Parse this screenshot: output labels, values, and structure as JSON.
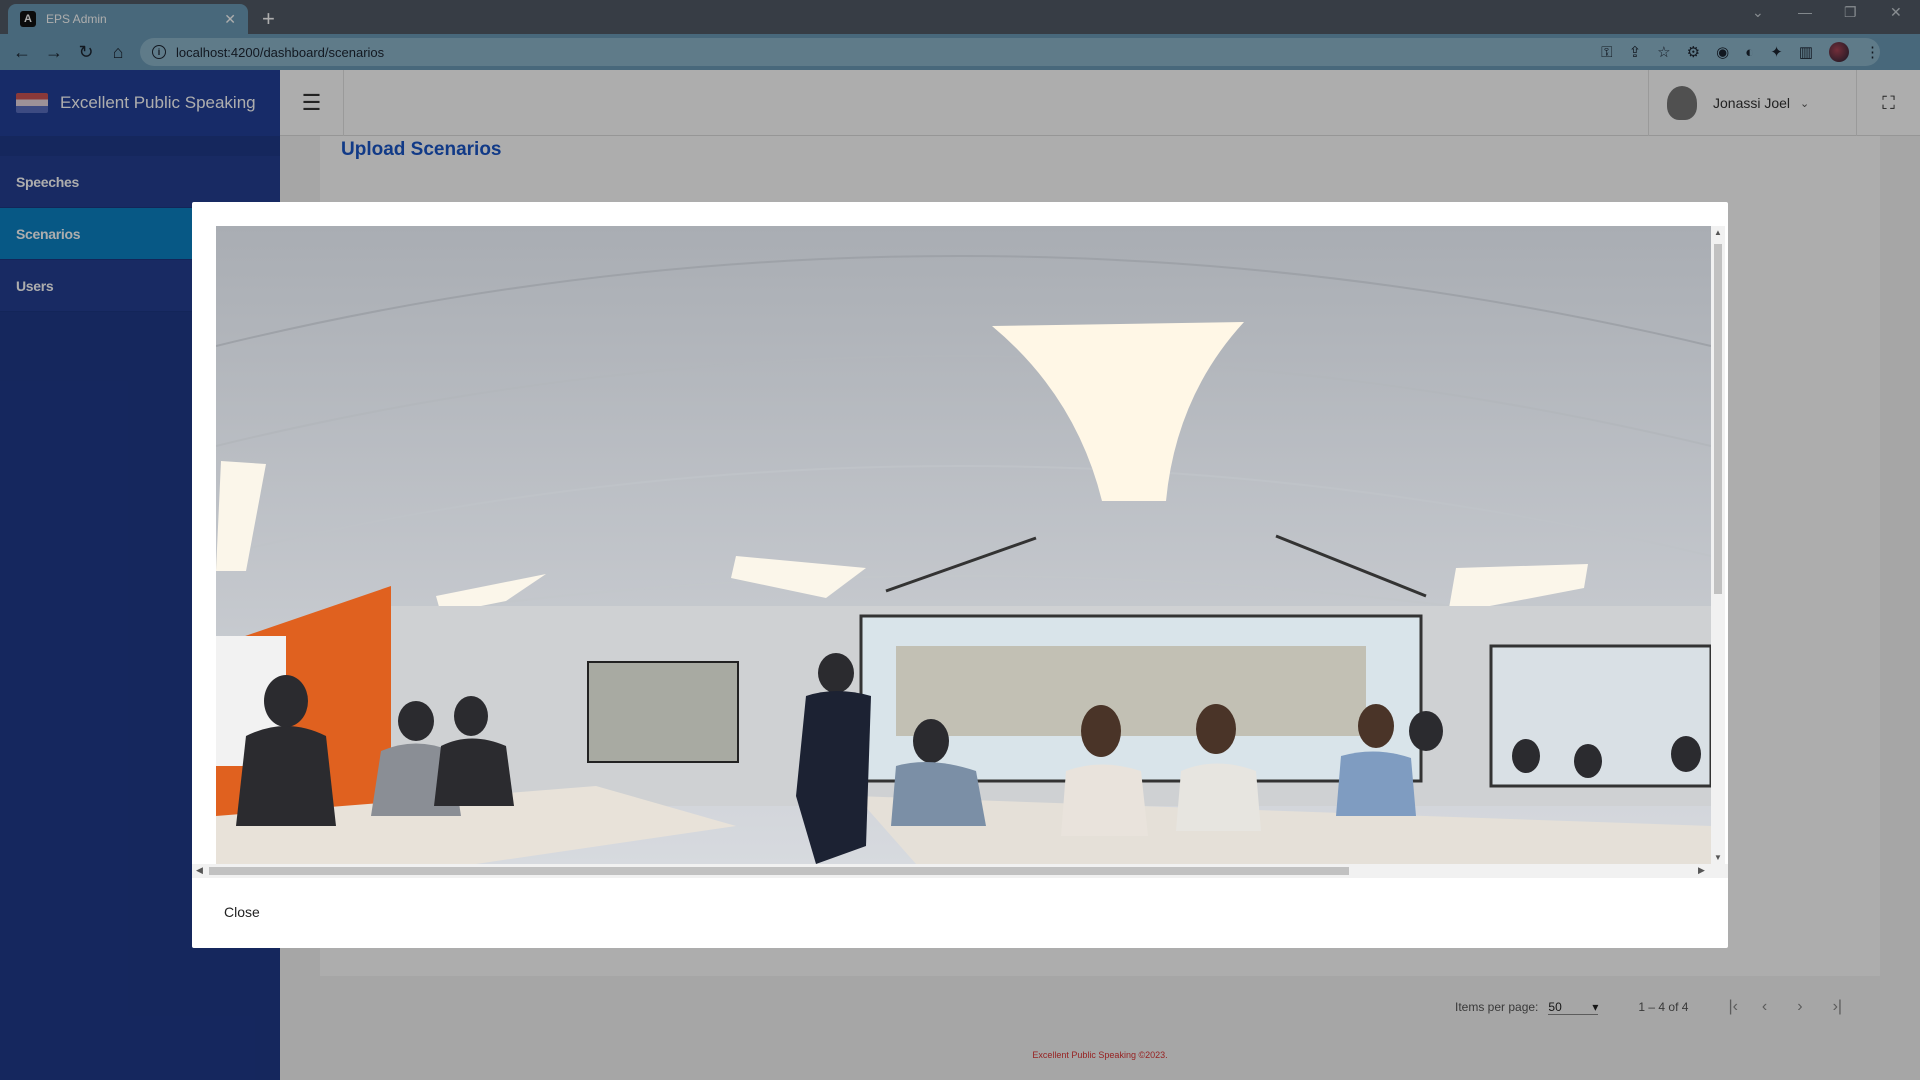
{
  "browser": {
    "tab_title": "EPS Admin",
    "url": "localhost:4200/dashboard/scenarios"
  },
  "app": {
    "brand": "Excellent Public Speaking",
    "nav": [
      {
        "label": "Speeches",
        "active": false
      },
      {
        "label": "Scenarios",
        "active": true
      },
      {
        "label": "Users",
        "active": false
      }
    ],
    "user_name": "Jonassi Joel",
    "page_title": "Upload Scenarios",
    "paginator": {
      "items_per_page_label": "Items per page:",
      "items_per_page": "50",
      "range": "1 – 4 of 4"
    },
    "footer": "Excellent Public Speaking ©2023."
  },
  "dialog": {
    "close_label": "Close",
    "image_icon": "panorama-classroom-image"
  },
  "colors": {
    "sidebar": "#1f3a8a",
    "active_nav": "#0b82c4",
    "title": "#1a56c8",
    "footer": "#dd3333"
  }
}
